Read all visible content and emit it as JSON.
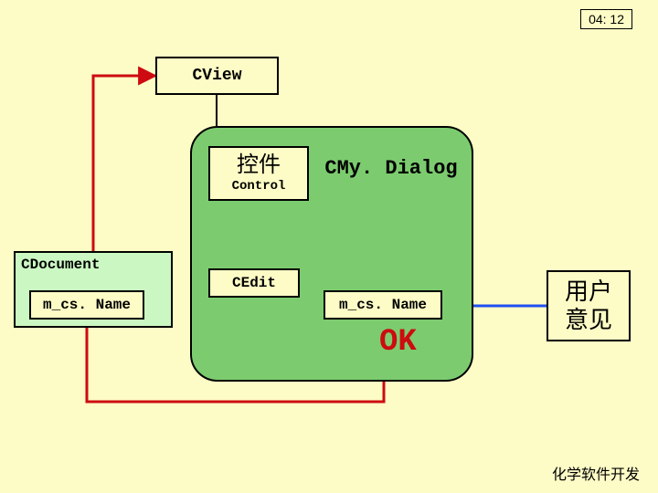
{
  "timestamp": "04: 12",
  "footer": "化学软件开发",
  "nodes": {
    "cview": "CView",
    "cdocument": "CDocument",
    "mcs_left": "m_cs. Name",
    "control_cn": "控件",
    "control_en": "Control",
    "cmydialog": "CMy. Dialog",
    "cedit": "CEdit",
    "mcs_right": "m_cs. Name",
    "ok": "OK",
    "user_opinion_l1": "用户",
    "user_opinion_l2": "意见"
  },
  "colors": {
    "bg": "#fdfcc6",
    "panel": "#7ccc6f",
    "doc_panel": "#cbf8c2",
    "arrow_red": "#cd0b10",
    "arrow_blue": "#2050f0"
  }
}
